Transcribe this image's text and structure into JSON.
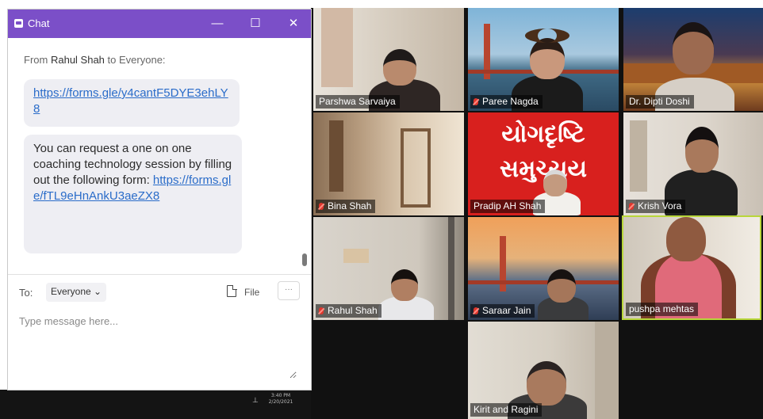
{
  "chat": {
    "title": "Chat",
    "window_controls": {
      "minimize": "—",
      "maximize": "☐",
      "close": "✕"
    },
    "from_prefix": "From",
    "from_sender": "Rahul Shah",
    "from_suffix": "to Everyone:",
    "messages": [
      {
        "link": "https://forms.gle/y4cantF5DYE3ehLY8"
      },
      {
        "text": "You can request a one on one coaching technology session by filling out the following form:",
        "link": "https://forms.gle/fTL9eHnAnkU3aeZX8"
      }
    ],
    "to_label": "To:",
    "to_value": "Everyone ⌄",
    "file_label": "File",
    "more_label": "···",
    "input_placeholder": "Type message here..."
  },
  "taskbar": {
    "time": "3:40 PM",
    "date": "2/20/2021"
  },
  "participants": [
    {
      "name": "Parshwa Sarvaiya",
      "muted": false
    },
    {
      "name": "Paree Nagda",
      "muted": true
    },
    {
      "name": "Dr. Dipti Doshi",
      "muted": true
    },
    {
      "name": "Bina Shah",
      "muted": true
    },
    {
      "name": "Pradip AH Shah",
      "muted": false
    },
    {
      "name": "Krish Vora",
      "muted": true
    },
    {
      "name": "Rahul Shah",
      "muted": true
    },
    {
      "name": "Saraar Jain",
      "muted": true
    },
    {
      "name": "pushpa mehtas",
      "muted": false,
      "active_speaker": true
    },
    {
      "name": "Kirit and Ragini",
      "muted": false
    }
  ],
  "background_text": {
    "line1": "યોગદૃષ્ટિ",
    "line2": "સમુચ્ચય"
  },
  "colors": {
    "title_bar": "#7b4fc8",
    "link": "#2a6cc9",
    "active_speaker_border": "#b8d63a",
    "muted_mic": "#e0362c"
  }
}
